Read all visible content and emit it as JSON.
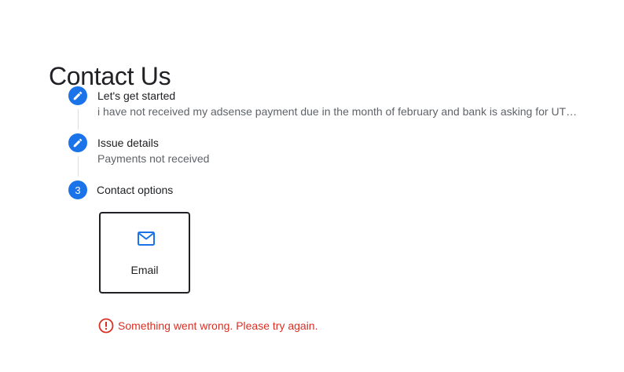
{
  "page": {
    "title": "Contact Us"
  },
  "steps": [
    {
      "marker": "edit",
      "title": "Let's get started",
      "subtitle": "i have not received my adsense payment due in the month of february and bank is asking for UT…"
    },
    {
      "marker": "edit",
      "title": "Issue details",
      "subtitle": "Payments not received"
    },
    {
      "marker": "3",
      "title": "Contact options"
    }
  ],
  "contact_options": [
    {
      "icon": "mail-icon",
      "label": "Email"
    }
  ],
  "error": {
    "icon": "error-icon",
    "message": "Something went wrong. Please try again."
  },
  "colors": {
    "accent": "#1a73e8",
    "error": "#d93025",
    "text": "#202124",
    "subtext": "#5f6368",
    "connector": "#dadce0"
  }
}
